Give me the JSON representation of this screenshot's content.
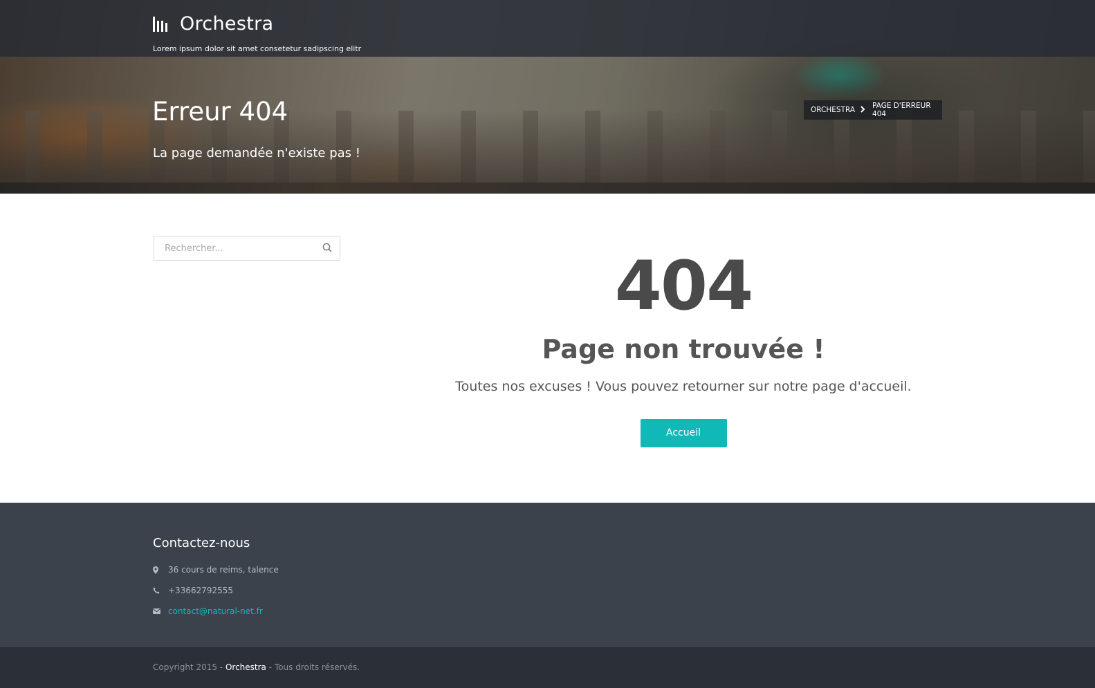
{
  "header": {
    "brand": "Orchestra",
    "tagline": "Lorem ipsum dolor sit amet consetetur sadipscing elitr"
  },
  "hero": {
    "title": "Erreur 404",
    "subtitle": "La page demandée n'existe pas !",
    "breadcrumb": [
      "ORCHESTRA",
      "PAGE D'ERREUR 404"
    ]
  },
  "sidebar": {
    "search_placeholder": "Rechercher..."
  },
  "error": {
    "code": "404",
    "title": "Page non trouvée !",
    "message": "Toutes nos excuses ! Vous pouvez retourner sur notre page d'accueil.",
    "button_label": "Accueil"
  },
  "footer": {
    "title": "Contactez-nous",
    "address": "36 cours de reims, talence",
    "phone": "+33662792555",
    "email": "contact@natural-net.fr",
    "copyright_prefix": "Copyright 2015 -",
    "copyright_brand": "Orchestra",
    "copyright_suffix": "- Tous droits réservés."
  },
  "icons": {
    "brand": "bars-logo-icon",
    "search": "search-icon",
    "breadcrumb_sep": "chevron-right-icon",
    "address": "map-marker-icon",
    "phone": "phone-icon",
    "email": "envelope-icon"
  },
  "colors": {
    "accent": "#10b9b8",
    "footer_bg": "#3b424c",
    "bottombar_bg": "#2b3038",
    "text_dark": "#4a4a4a"
  }
}
